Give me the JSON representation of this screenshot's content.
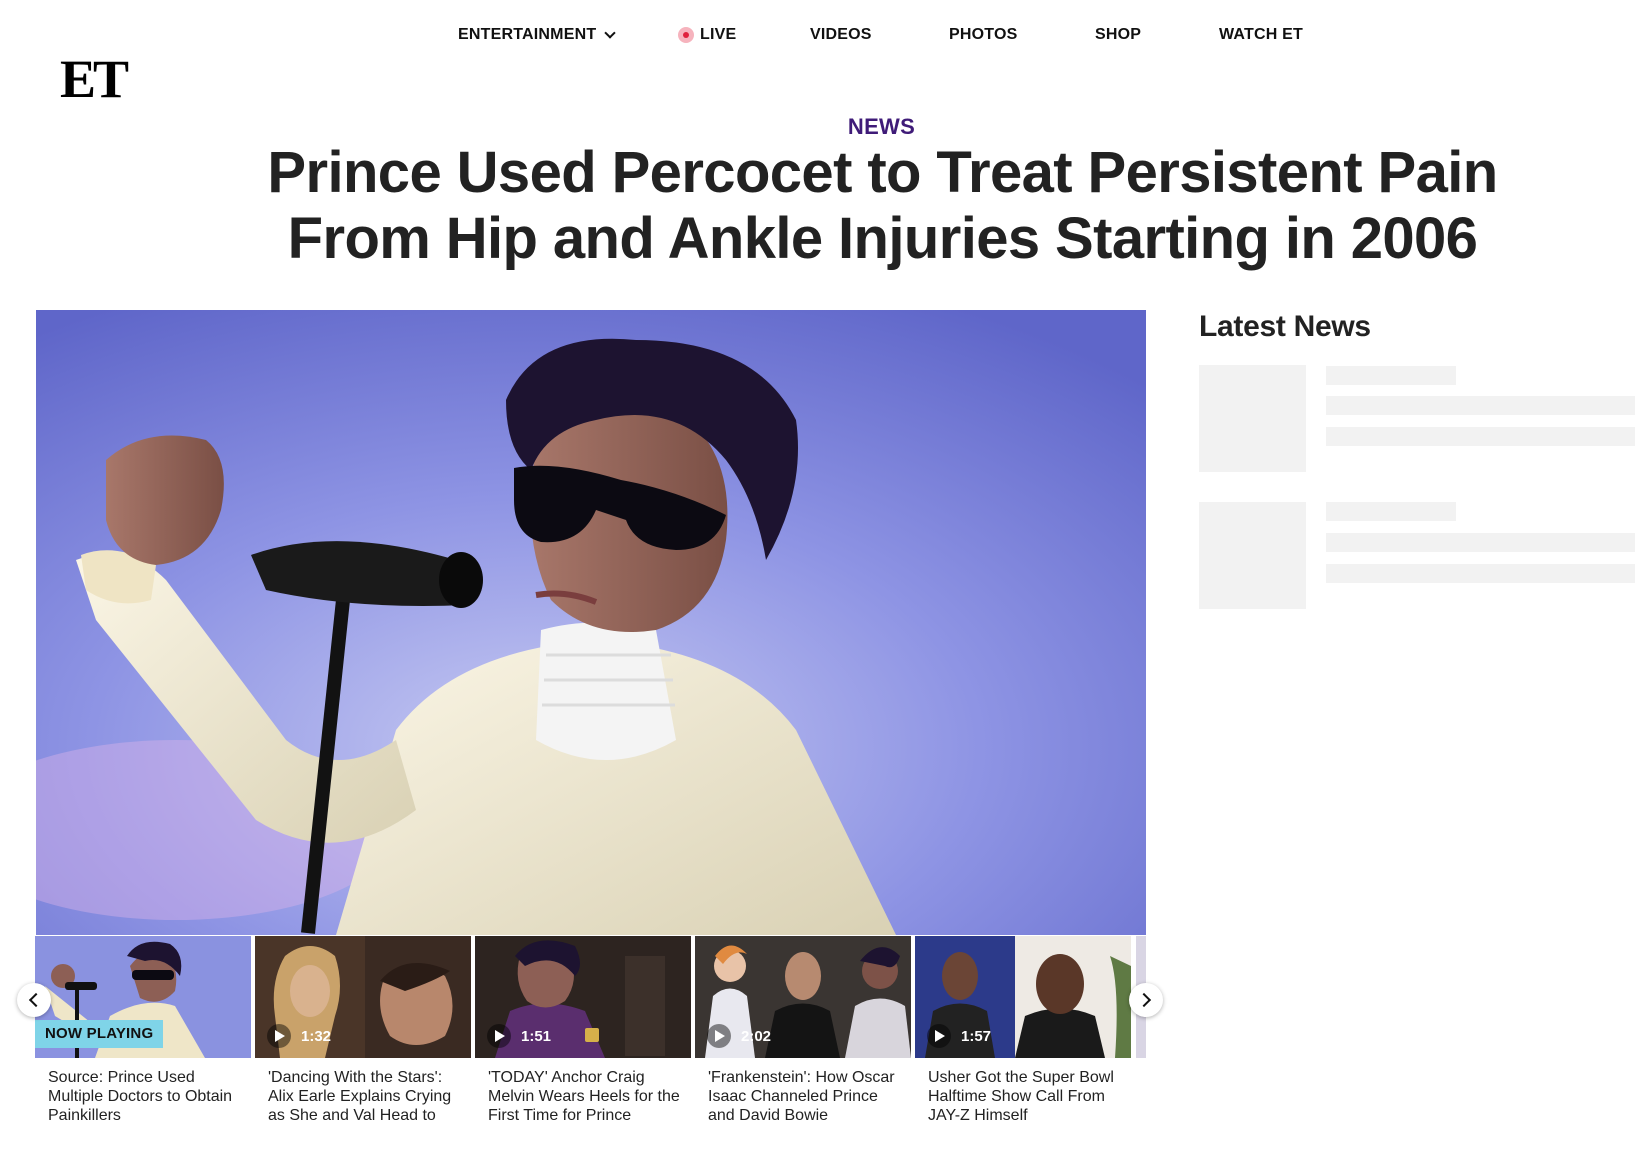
{
  "brand": {
    "logo_text": "ET"
  },
  "nav": {
    "items": [
      {
        "label": "ENTERTAINMENT",
        "has_dropdown": true
      },
      {
        "label": "LIVE",
        "live_indicator": true
      },
      {
        "label": "VIDEOS"
      },
      {
        "label": "PHOTOS"
      },
      {
        "label": "SHOP"
      },
      {
        "label": "WATCH ET"
      }
    ]
  },
  "article": {
    "category": "NEWS",
    "headline": "Prince Used Percocet to Treat Persistent Pain From Hip and Ankle Injuries Starting in 2006",
    "hero_image": "Prince performing on stage in white turtleneck and jacket, sunglasses, at microphone, purple-blue background"
  },
  "video_strip": {
    "items": [
      {
        "status": "NOW PLAYING",
        "caption": "Source: Prince Used Multiple Doctors to Obtain Painkillers"
      },
      {
        "duration": "1:32",
        "caption": "'Dancing With the Stars': Alix Earle Explains Crying as She and Val Head to"
      },
      {
        "duration": "1:51",
        "caption": "'TODAY' Anchor Craig Melvin Wears Heels for the First Time for Prince"
      },
      {
        "duration": "2:02",
        "caption": "'Frankenstein': How Oscar Isaac Channeled Prince and David Bowie"
      },
      {
        "duration": "1:57",
        "caption": "Usher Got the Super Bowl Halftime Show Call From JAY-Z Himself"
      }
    ]
  },
  "sidebar": {
    "title": "Latest News"
  },
  "colors": {
    "category": "#3f1b78",
    "now_playing_bg": "#7fd4e8",
    "live": "#e0213d",
    "hero_bg": "#7d85de"
  }
}
